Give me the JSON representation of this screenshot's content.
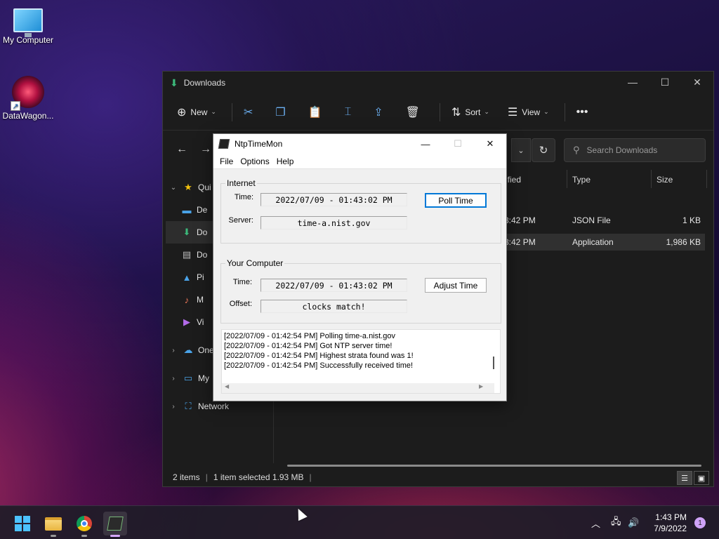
{
  "desktop": {
    "icons": [
      {
        "label": "My Computer"
      },
      {
        "label": "DataWagon..."
      }
    ]
  },
  "explorer": {
    "title": "Downloads",
    "toolbar": {
      "new_label": "New",
      "sort_label": "Sort",
      "view_label": "View"
    },
    "search_placeholder": "Search Downloads",
    "columns": [
      "ified",
      "Type",
      "Size"
    ],
    "rows": [
      {
        "date": "3:42 PM",
        "type": "JSON File",
        "size": "1 KB"
      },
      {
        "date": "3:42 PM",
        "type": "Application",
        "size": "1,986 KB"
      }
    ],
    "sidebar": {
      "quick_access": "Qui",
      "items": [
        "De",
        "Do",
        "Do",
        "Pi",
        "M",
        "Vi"
      ],
      "onedrive": "One",
      "my": "My",
      "network": "Network"
    },
    "status": {
      "items": "2 items",
      "selected": "1 item selected  1.93 MB"
    }
  },
  "ntp": {
    "title": "NtpTimeMon",
    "menu": [
      "File",
      "Options",
      "Help"
    ],
    "internet": {
      "group_label": "Internet",
      "time_label": "Time:",
      "time_value": "2022/07/09 - 01:43:02 PM",
      "server_label": "Server:",
      "server_value": "time-a.nist.gov",
      "button": "Poll Time"
    },
    "computer": {
      "group_label": "Your Computer",
      "time_label": "Time:",
      "time_value": "2022/07/09 - 01:43:02 PM",
      "offset_label": "Offset:",
      "offset_value": "clocks match!",
      "button": "Adjust Time"
    },
    "log": [
      "[2022/07/09 - 01:42:54 PM] Polling time-a.nist.gov",
      "[2022/07/09 - 01:42:54 PM] Got NTP server time!",
      "[2022/07/09 - 01:42:54 PM] Highest strata found was 1!",
      "[2022/07/09 - 01:42:54 PM] Successfully received time!"
    ]
  },
  "taskbar": {
    "time": "1:43 PM",
    "date": "7/9/2022",
    "notifications": "1"
  }
}
